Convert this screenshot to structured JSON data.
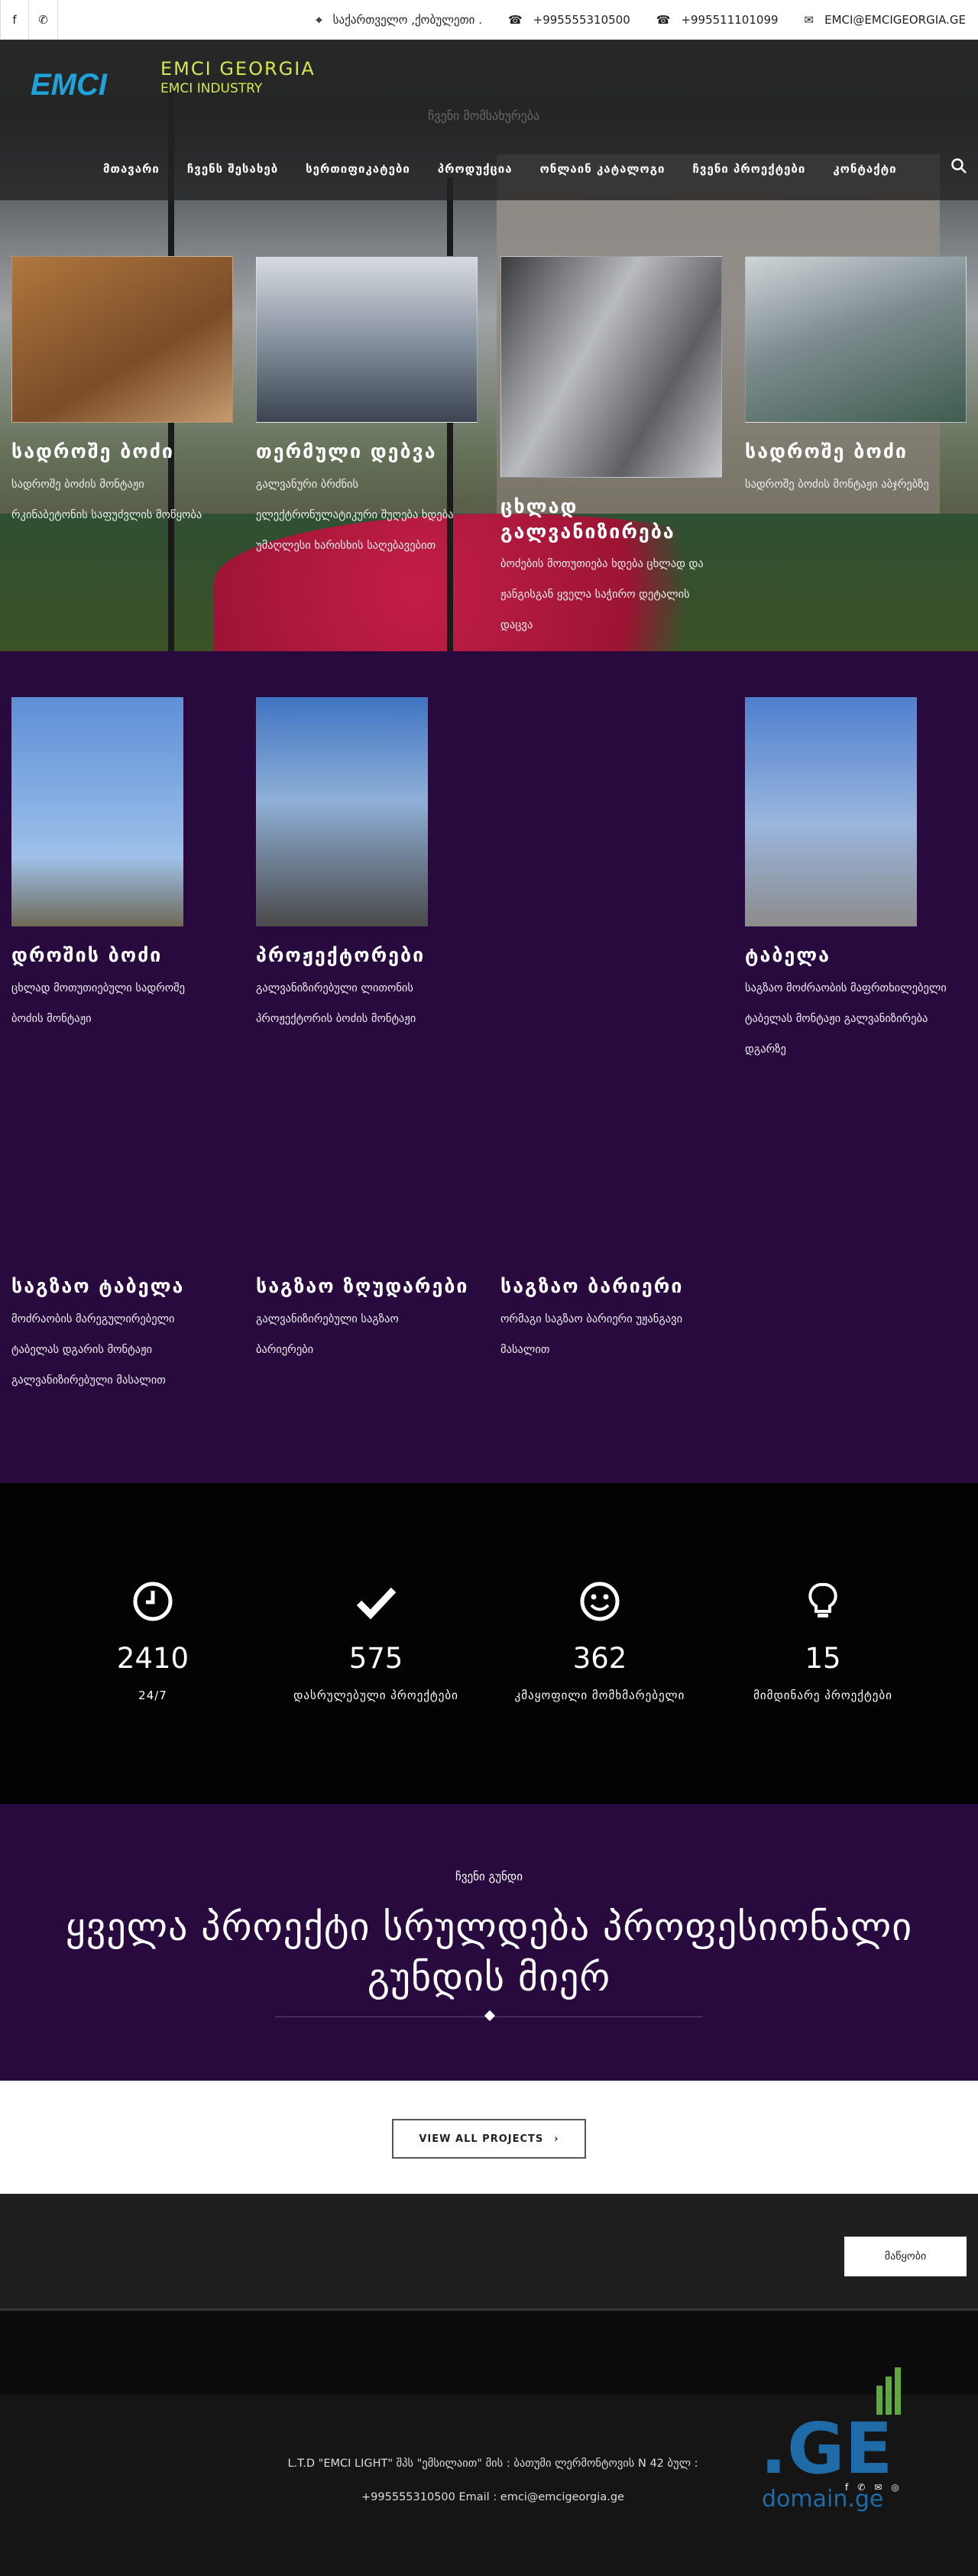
{
  "topbar": {
    "social": [
      {
        "icon": "facebook-icon",
        "glyph": "f"
      },
      {
        "icon": "whatsapp-icon",
        "glyph": "✆"
      }
    ],
    "address": "საქართველო ,ქობულეთი .",
    "phone1": "+995555310500",
    "phone2": "+995511101099",
    "email": "EMCI@EMCIGEORGIA.GE"
  },
  "header": {
    "logo_text": "EMCI",
    "brand_name": "EMCI GEORGIA",
    "brand_sub": "EMCI INDUSTRY",
    "ghost_text": "ჩვენი მომსახურება",
    "nav": [
      "მთავარი",
      "ჩვენს შესახებ",
      "სერთიფიკატები",
      "პროდუქცია",
      "ონლაინ კატალოგი",
      "ჩვენი პროექტები",
      "კონტაქტი"
    ]
  },
  "hero_cards": [
    {
      "title": "სადროშე ბოძი",
      "lines": [
        "სადროშე ბოძის მონტაჟი",
        "რკინაბეტონის საფუძვლის მოწყობა"
      ]
    },
    {
      "title": "თერმული დებვა",
      "lines": [
        "გალვანური ბრძნის",
        "ელექტრონულატიკური შუღება ხდება",
        "უმაღლესი ხარისხის საღებავებით"
      ]
    },
    {
      "title": "ცხლად გალვანიზირება",
      "lines": [
        "ბოძების მოთუთიება ხდება ცხლად და",
        "ჟანგისგან ყველა საჭირო დეტალის",
        "დაცვა"
      ]
    },
    {
      "title": "სადროშე ბოძი",
      "lines": [
        "სადროშე ბოძის მონტაჟი აბჯრებზე"
      ]
    }
  ],
  "projects": [
    {
      "title": "დროშის ბოძი",
      "lines": [
        "ცხლად მოთუთიებული სადროშე",
        "ბოძის მონტაჟი"
      ]
    },
    {
      "title": "პროჟექტორები",
      "lines": [
        "გალვანიზირებული ლითონის",
        "პროჟექტორის ბოძის მონტაჟი"
      ]
    },
    {
      "title": "ტაბელა",
      "lines": [
        "საგზაო მოძრაობის მაფრთხილებელი",
        "ტაბელას მონტაჟი გალვანიზირება",
        "დგარზე"
      ]
    },
    {
      "title": "საგზაო ტაბელა",
      "lines": [
        "მოძრაობის მარეგულირებელი",
        "ტაბელას დგარის მონტაჟი",
        "გალვანიზირებული მასალით"
      ]
    },
    {
      "title": "საგზაო ზღუდარები",
      "lines": [
        "გალვანიზირებული საგზაო",
        "ბარიერები"
      ]
    },
    {
      "title": "საგზაო ბარიერი",
      "lines": [
        "ორმაგი საგზაო ბარიერი უჟანგავი",
        "მასალით"
      ]
    }
  ],
  "stats": [
    {
      "icon": "clock-icon",
      "value": "2410",
      "label": "24/7"
    },
    {
      "icon": "checkmark-icon",
      "value": "575",
      "label": "დასრულებული პროექტები"
    },
    {
      "icon": "smiley-icon",
      "value": "362",
      "label": "კმაყოფილი მომხმარებელი"
    },
    {
      "icon": "lightbulb-icon",
      "value": "15",
      "label": "მიმდინარე პროექტები"
    }
  ],
  "team": {
    "kicker": "ჩვენი გუნდი",
    "headline_1": "ყველა პროექტი სრულდება პროფესიონალი",
    "headline_2": "გუნდის მიერ"
  },
  "projects_button": "VIEW ALL PROJECTS",
  "main_button": "მაწყობი",
  "footer": {
    "line1": "L.T.D \"EMCI LIGHT\" შპს \"ემსილაით\" მის : ბათუმი ლერმონტოვის N 42 ბულ :",
    "line2": "+995555310500 Email : emci@emcigeorgia.ge",
    "ge_text": ".GE",
    "domain_text": "domain.ge"
  }
}
